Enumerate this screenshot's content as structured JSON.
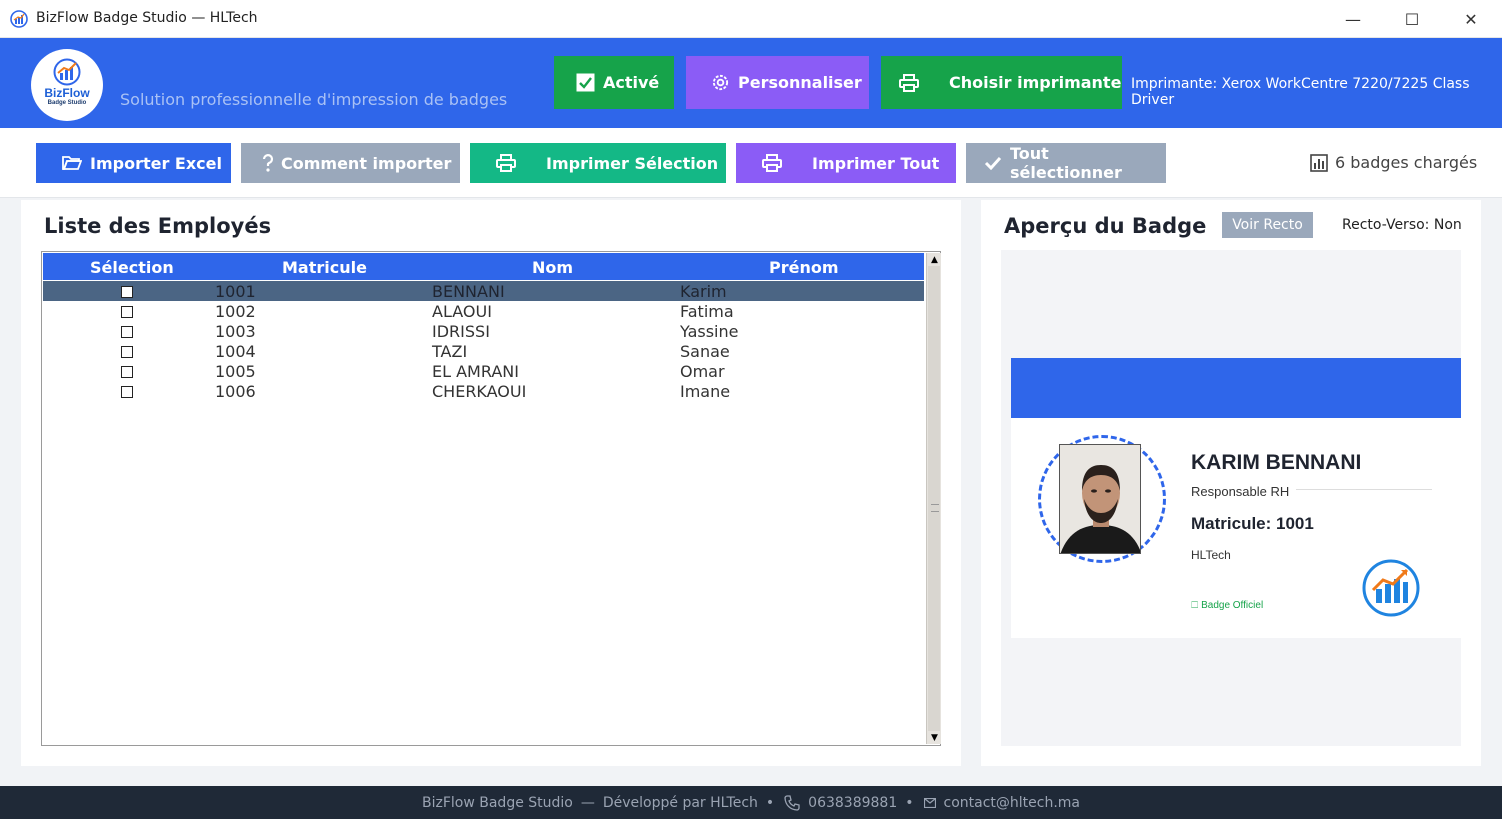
{
  "window": {
    "title": "BizFlow Badge Studio — HLTech",
    "min_glyph": "—",
    "max_glyph": "☐",
    "close_glyph": "✕"
  },
  "header": {
    "logo_text": "BizFlow",
    "logo_sub": "Badge Studio",
    "tagline": "Solution professionnelle d'impression de badges",
    "active_label": "Activé",
    "customize_label": "Personnaliser",
    "choose_printer_label": "Choisir imprimante",
    "printer_info": "Imprimante: Xerox WorkCentre 7220/7225 Class Driver"
  },
  "toolbar": {
    "import_label": "Importer Excel",
    "how_label": "Comment importer",
    "print_selection_label": "Imprimer Sélection",
    "print_all_label": "Imprimer Tout",
    "select_all_label": "Tout sélectionner",
    "loaded_status": "6 badges chargés"
  },
  "employees": {
    "title": "Liste des Employés",
    "columns": [
      "Sélection",
      "Matricule",
      "Nom",
      "Prénom"
    ],
    "rows": [
      {
        "matricule": "1001",
        "nom": "BENNANI",
        "prenom": "Karim",
        "selected_row": true
      },
      {
        "matricule": "1002",
        "nom": "ALAOUI",
        "prenom": "Fatima",
        "selected_row": false
      },
      {
        "matricule": "1003",
        "nom": "IDRISSI",
        "prenom": "Yassine",
        "selected_row": false
      },
      {
        "matricule": "1004",
        "nom": "TAZI",
        "prenom": "Sanae",
        "selected_row": false
      },
      {
        "matricule": "1005",
        "nom": "EL AMRANI",
        "prenom": "Omar",
        "selected_row": false
      },
      {
        "matricule": "1006",
        "nom": "CHERKAOUI",
        "prenom": "Imane",
        "selected_row": false
      }
    ]
  },
  "preview": {
    "title": "Aperçu du Badge",
    "voir_recto": "Voir Recto",
    "recto_verso": "Recto-Verso: Non",
    "name": "KARIM BENNANI",
    "role": "Responsable RH",
    "matricule": "Matricule: 1001",
    "company": "HLTech",
    "official": "🗆 Badge Officiel"
  },
  "footer": {
    "app": "BizFlow Badge Studio",
    "dash": "—",
    "dev": "Développé par HLTech",
    "bullet": "•",
    "phone": "0638389881",
    "email": "contact@hltech.ma"
  },
  "colors": {
    "primary": "#2f66ea",
    "green": "#16a34a",
    "teal": "#14b886",
    "purple": "#8b5cf6",
    "gray": "#9aa8bb",
    "footer": "#1f2937"
  }
}
